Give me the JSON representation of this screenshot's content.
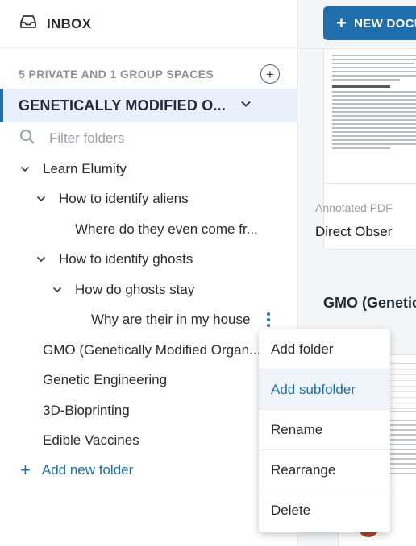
{
  "sidebar": {
    "inbox_label": "INBOX",
    "spaces_label": "5 PRIVATE AND 1 GROUP SPACES",
    "add_space_symbol": "+",
    "selected_space": "GENETICALLY MODIFIED O...",
    "filter_placeholder": "Filter folders",
    "tree": {
      "learn": "Learn Elumity",
      "aliens": "How to identify aliens",
      "aliens_child": "Where do they even come fr...",
      "ghosts": "How to identify ghosts",
      "ghosts_stay": "How do ghosts stay",
      "ghosts_house": "Why are their in my house",
      "gmo": "GMO (Genetically Modified Organ...",
      "genetic_eng": "Genetic Engineering",
      "bioprinting": "3D-Bioprinting",
      "vaccines": "Edible Vaccines"
    },
    "add_new_folder": "Add new folder"
  },
  "right": {
    "new_doc_label": "NEW DOCU",
    "doc_type": "Annotated PDF",
    "doc_title": "Direct Obser",
    "section_title": "GMO (Genetic"
  },
  "context_menu": {
    "items": [
      "Add folder",
      "Add subfolder",
      "Rename",
      "Rearrange",
      "Delete"
    ]
  },
  "colors": {
    "accent": "#1f6fae",
    "selected_bg": "#e8f1f9",
    "muted_text": "#8d9297"
  }
}
